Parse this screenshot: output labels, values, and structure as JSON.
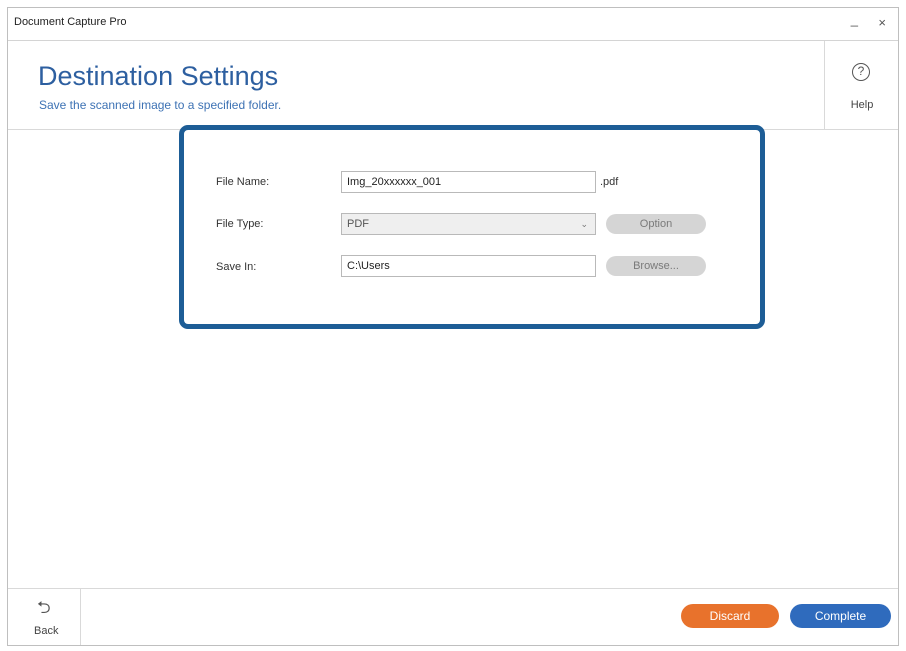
{
  "window": {
    "title": "Document Capture Pro",
    "minimize_glyph": "_",
    "close_glyph": "×"
  },
  "header": {
    "title": "Destination Settings",
    "subtitle": "Save the scanned image to a specified folder.",
    "help_label": "Help",
    "help_icon": "question-circle-icon",
    "help_glyph": "?"
  },
  "form": {
    "file_name": {
      "label": "File Name:",
      "value": "Img_20xxxxxx_001",
      "extension": ".pdf"
    },
    "file_type": {
      "label": "File Type:",
      "selected": "PDF",
      "option_button": "Option"
    },
    "save_in": {
      "label": "Save In:",
      "value": "C:\\Users",
      "browse_button": "Browse..."
    }
  },
  "footer": {
    "back_label": "Back",
    "back_glyph": "⮌",
    "discard_label": "Discard",
    "complete_label": "Complete"
  },
  "colors": {
    "accent": "#2d5fa0",
    "highlight_border": "#1d5d96",
    "discard": "#e8722c",
    "complete": "#2f6bbd"
  }
}
